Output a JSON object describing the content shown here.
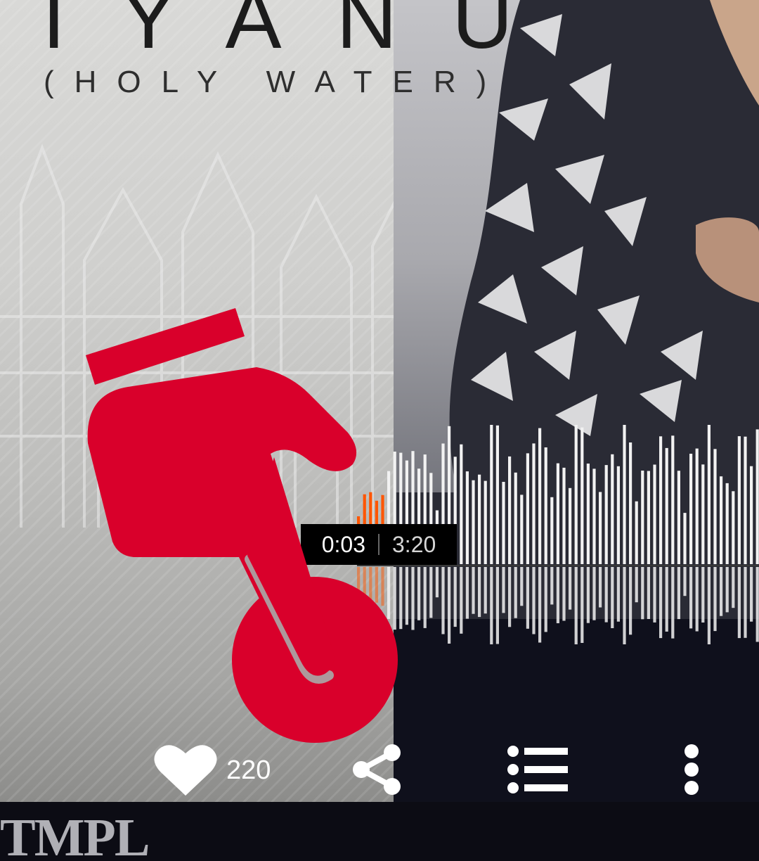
{
  "artwork": {
    "title": "IYANU",
    "subtitle": "(HOLY WATER)",
    "label": "TMPL"
  },
  "player": {
    "current_time": "0:03",
    "total_time": "3:20",
    "progress_fraction": 0.015,
    "played_color": "#ff5500",
    "unplayed_color": "#f2f2f2"
  },
  "actions": {
    "like_count": "220",
    "like_icon": "heart-icon",
    "share_icon": "share-icon",
    "queue_icon": "playlist-icon",
    "more_icon": "more-vertical-icon"
  },
  "overlay": {
    "hand_icon": "pointing-hand-icon",
    "hand_color": "#d9002b"
  }
}
